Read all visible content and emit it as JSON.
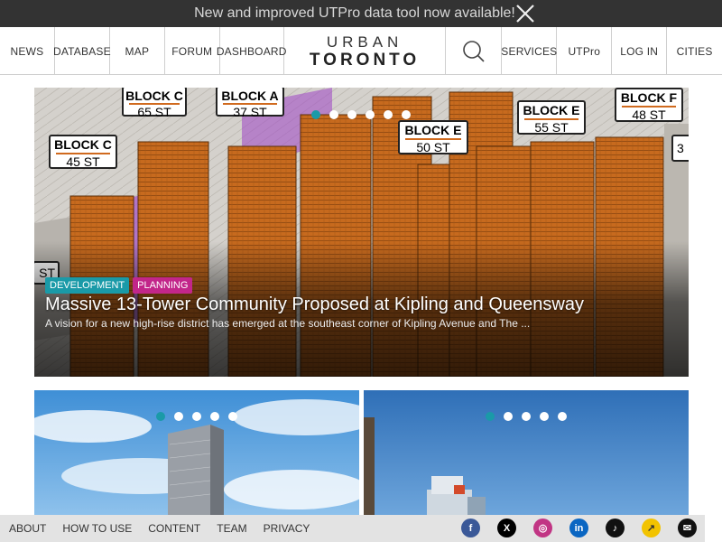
{
  "announcement": {
    "text": "New and improved UTPro data tool now available!"
  },
  "nav": {
    "left": [
      "NEWS",
      "DATABASE",
      "MAP",
      "FORUM",
      "DASHBOARD"
    ],
    "logo": {
      "line1": "URBAN",
      "line2": "TORONTO"
    },
    "right": [
      "SERVICES",
      "UTPro",
      "LOG IN",
      "CITIES"
    ]
  },
  "hero": {
    "tags": [
      {
        "label": "DEVELOPMENT",
        "color": "#1a9aa8"
      },
      {
        "label": "PLANNING",
        "color": "#c2268a"
      }
    ],
    "title": "Massive 13-Tower Community Proposed at Kipling and Queensway",
    "subtitle": "A vision for a new high-rise district has emerged at the southeast corner of Kipling Avenue and The ...",
    "block_labels": [
      {
        "block": "BLOCK C",
        "storeys": "65 ST"
      },
      {
        "block": "BLOCK A",
        "storeys": "37 ST"
      },
      {
        "block": "BLOCK C",
        "storeys": "45 ST"
      },
      {
        "block": "BLOCK E",
        "storeys": "50 ST"
      },
      {
        "block": "BLOCK E",
        "storeys": "55 ST"
      },
      {
        "block": "BLOCK F",
        "storeys": "48 ST"
      },
      {
        "block": "",
        "storeys": "ST"
      },
      {
        "block": "",
        "storeys": "3"
      }
    ],
    "dots": 6,
    "active_dot": 0
  },
  "cards": [
    {
      "dots": 5,
      "active_dot": 0
    },
    {
      "dots": 5,
      "active_dot": 0
    }
  ],
  "footer": {
    "links": [
      "ABOUT",
      "HOW TO USE",
      "CONTENT",
      "TEAM",
      "PRIVACY"
    ],
    "social": [
      {
        "icon": "facebook-icon",
        "glyph": "f",
        "color": "#3b5998"
      },
      {
        "icon": "x-icon",
        "glyph": "X",
        "color": "#000000"
      },
      {
        "icon": "instagram-icon",
        "glyph": "◎",
        "color": "#c13584"
      },
      {
        "icon": "linkedin-icon",
        "glyph": "in",
        "color": "#0a66c2"
      },
      {
        "icon": "tiktok-icon",
        "glyph": "♪",
        "color": "#111111"
      },
      {
        "icon": "trend-icon",
        "glyph": "↗",
        "color": "#f2c300"
      },
      {
        "icon": "email-icon",
        "glyph": "✉",
        "color": "#111111"
      }
    ]
  },
  "colors": {
    "accent": "#1a9aa8",
    "planning": "#c2268a",
    "tower": "#c76a1e",
    "dark_bar": "#333333"
  }
}
